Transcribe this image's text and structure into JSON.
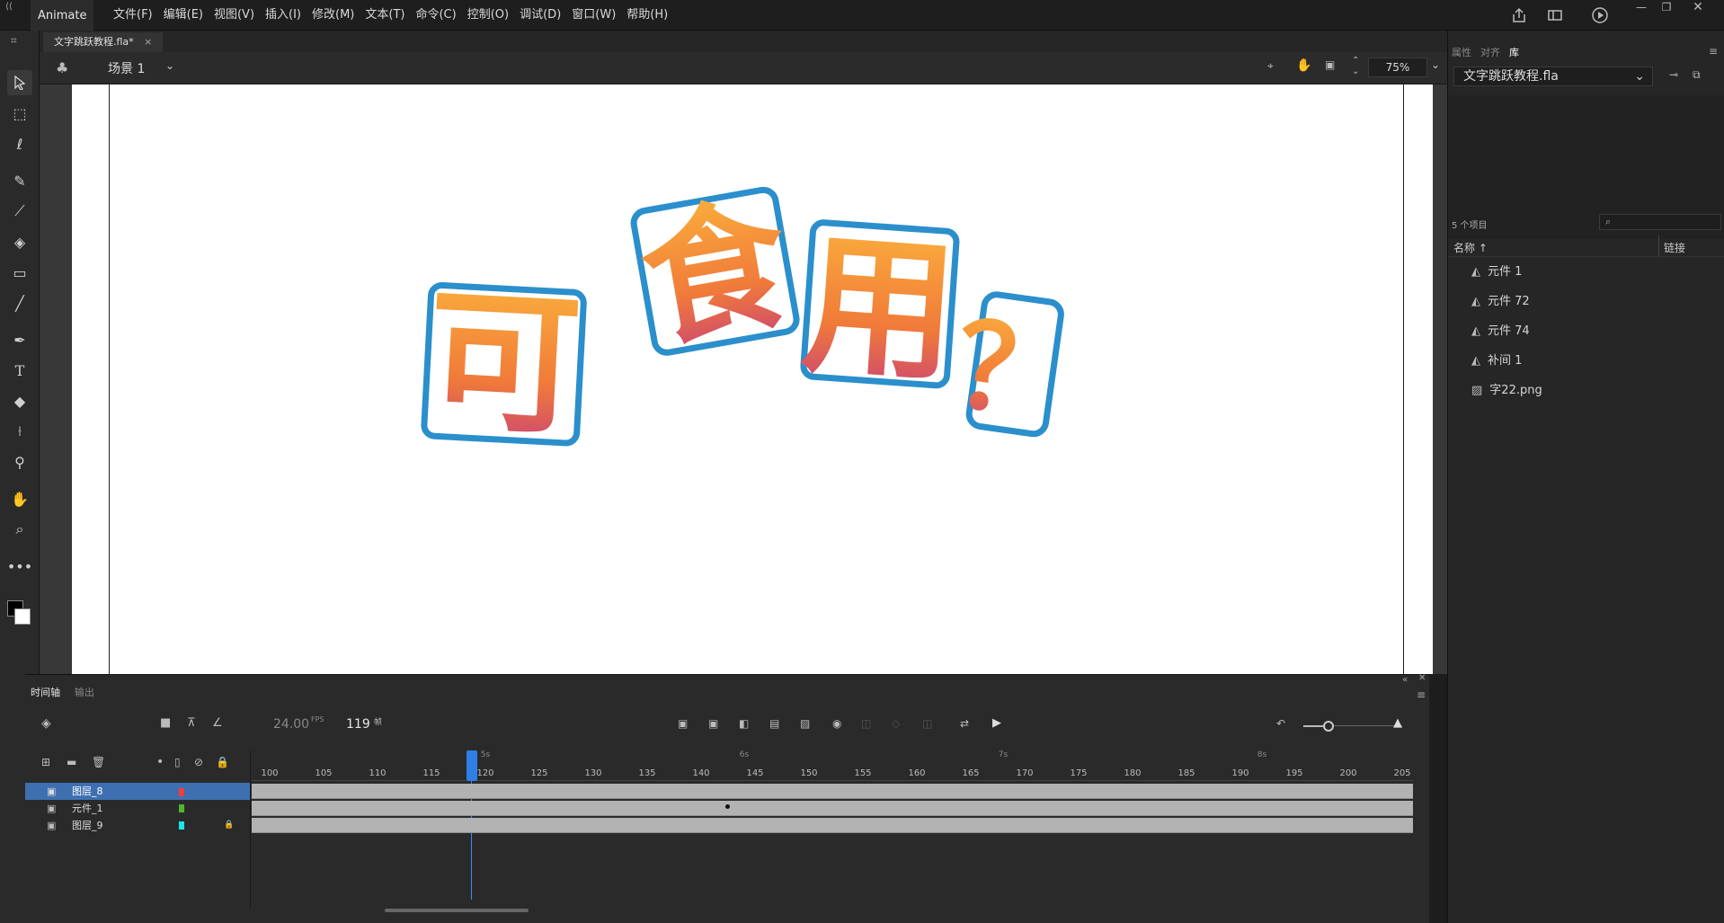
{
  "app": {
    "name": "Animate"
  },
  "menu": [
    "文件(F)",
    "编辑(E)",
    "视图(V)",
    "插入(I)",
    "修改(M)",
    "文本(T)",
    "命令(C)",
    "控制(O)",
    "调试(D)",
    "窗口(W)",
    "帮助(H)"
  ],
  "document": {
    "tab_label": "文字跳跃教程.fla*",
    "close": "×"
  },
  "scene": {
    "label": "场景 1",
    "zoom": "75%"
  },
  "stage": {
    "text_chars": [
      "可",
      "食",
      "用",
      "？"
    ]
  },
  "timeline": {
    "tabs": [
      "时间轴",
      "输出"
    ],
    "fps": "24.00",
    "fps_unit": "FPS",
    "current_frame": "119",
    "frame_unit": "帧",
    "ruler_ticks": [
      "100",
      "105",
      "110",
      "115",
      "120",
      "125",
      "130",
      "135",
      "140",
      "145",
      "150",
      "155",
      "160",
      "165",
      "170",
      "175",
      "180",
      "185",
      "190",
      "195",
      "200",
      "205"
    ],
    "time_marks": [
      "5s",
      "6s",
      "7s",
      "8s"
    ],
    "layers": [
      {
        "name": "图层_8",
        "color": "#ff3b3b",
        "selected": true,
        "locked": false
      },
      {
        "name": "元件_1",
        "color": "#4cb82c",
        "selected": false,
        "locked": false
      },
      {
        "name": "图层_9",
        "color": "#19e6e6",
        "selected": false,
        "locked": true
      }
    ]
  },
  "panel": {
    "tabs": [
      "属性",
      "对齐",
      "库"
    ],
    "library_file": "文字跳跃教程.fla",
    "item_count": "5 个项目",
    "search_placeholder": "",
    "col_name": "名称 ↑",
    "col_link": "链接",
    "items": [
      {
        "name": "元件 1",
        "icon": "symbol-icon"
      },
      {
        "name": "元件 72",
        "icon": "symbol-icon"
      },
      {
        "name": "元件 74",
        "icon": "symbol-icon"
      },
      {
        "name": "补间 1",
        "icon": "symbol-icon"
      },
      {
        "name": "字22.png",
        "icon": "bitmap-icon"
      }
    ]
  }
}
